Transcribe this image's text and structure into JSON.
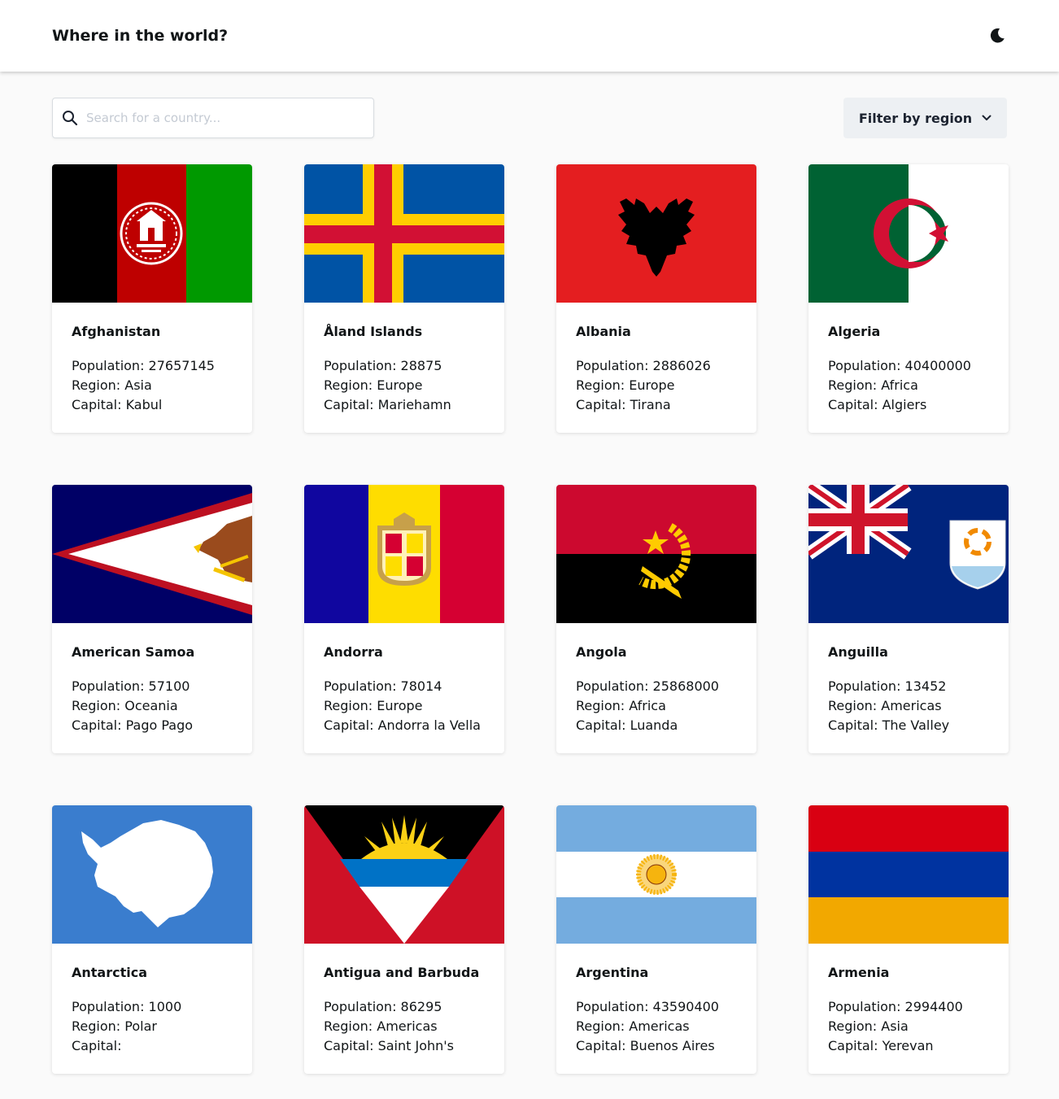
{
  "header": {
    "title": "Where in the world?",
    "theme_icon": "moon-icon"
  },
  "search": {
    "placeholder": "Search for a country...",
    "value": "",
    "icon": "search-icon"
  },
  "filter": {
    "label": "Filter by region",
    "icon": "chevron-down-icon"
  },
  "labels": {
    "population": "Population: ",
    "region": "Region: ",
    "capital": "Capital: "
  },
  "countries": [
    {
      "name": "Afghanistan",
      "population": "27657145",
      "region": "Asia",
      "capital": "Kabul",
      "flag": "afghanistan-flag"
    },
    {
      "name": "Åland Islands",
      "population": "28875",
      "region": "Europe",
      "capital": "Mariehamn",
      "flag": "aland-islands-flag"
    },
    {
      "name": "Albania",
      "population": "2886026",
      "region": "Europe",
      "capital": "Tirana",
      "flag": "albania-flag"
    },
    {
      "name": "Algeria",
      "population": "40400000",
      "region": "Africa",
      "capital": "Algiers",
      "flag": "algeria-flag"
    },
    {
      "name": "American Samoa",
      "population": "57100",
      "region": "Oceania",
      "capital": "Pago Pago",
      "flag": "american-samoa-flag"
    },
    {
      "name": "Andorra",
      "population": "78014",
      "region": "Europe",
      "capital": "Andorra la Vella",
      "flag": "andorra-flag"
    },
    {
      "name": "Angola",
      "population": "25868000",
      "region": "Africa",
      "capital": "Luanda",
      "flag": "angola-flag"
    },
    {
      "name": "Anguilla",
      "population": "13452",
      "region": "Americas",
      "capital": "The Valley",
      "flag": "anguilla-flag"
    },
    {
      "name": "Antarctica",
      "population": "1000",
      "region": "Polar",
      "capital": "",
      "flag": "antarctica-flag"
    },
    {
      "name": "Antigua and Barbuda",
      "population": "86295",
      "region": "Americas",
      "capital": "Saint John's",
      "flag": "antigua-and-barbuda-flag"
    },
    {
      "name": "Argentina",
      "population": "43590400",
      "region": "Americas",
      "capital": "Buenos Aires",
      "flag": "argentina-flag"
    },
    {
      "name": "Armenia",
      "population": "2994400",
      "region": "Asia",
      "capital": "Yerevan",
      "flag": "armenia-flag"
    }
  ]
}
